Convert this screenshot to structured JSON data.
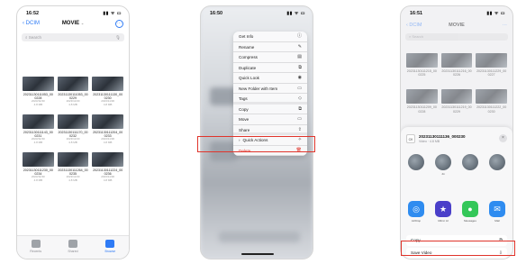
{
  "screen1": {
    "time": "16:52",
    "status_icons": "▮▮ ᯤ ▭",
    "back_label": "DCIM",
    "title": "MOVIE",
    "more_label": "···",
    "search_placeholder": "Search",
    "items": [
      {
        "name": "20231130111053_000228",
        "meta": "2023/11/30\n4.8 MB"
      },
      {
        "name": "20231130111053_000229",
        "meta": "2023/11/30\n4.8 MB"
      },
      {
        "name": "20231130111130_000230",
        "meta": "2023/11/30\n4.8 MB"
      },
      {
        "name": "20231130111143_000231",
        "meta": "2023/11/30\n4.8 MB"
      },
      {
        "name": "20231130111170_000232",
        "meta": "2023/11/30\n4.8 MB"
      },
      {
        "name": "20231130111204_000233",
        "meta": "2023/11/30\n4.8 MB"
      },
      {
        "name": "20231130111230_000234",
        "meta": "2023/11/30\n4.8 MB"
      },
      {
        "name": "20231130111264_000235",
        "meta": "2023/11/30\n4.8 MB"
      },
      {
        "name": "20231130111224_000236",
        "meta": "2023/11/30\n4.8 MB"
      }
    ],
    "tabs": [
      {
        "label": "Recents",
        "active": false
      },
      {
        "label": "Shared",
        "active": false
      },
      {
        "label": "Browse",
        "active": true
      }
    ]
  },
  "screen2": {
    "time": "16:50",
    "status_icons": "▮▮ ᯤ ▭",
    "menu": [
      {
        "label": "Get Info",
        "icon": "ⓘ",
        "icon_name": "info-icon",
        "sep": false,
        "red": false
      },
      {
        "label": "Rename",
        "icon": "✎",
        "icon_name": "pencil-icon",
        "sep": false,
        "red": false
      },
      {
        "label": "Compress",
        "icon": "▤",
        "icon_name": "archive-icon",
        "sep": false,
        "red": false
      },
      {
        "label": "Duplicate",
        "icon": "⧉",
        "icon_name": "duplicate-icon",
        "sep": false,
        "red": false
      },
      {
        "label": "Quick Look",
        "icon": "◉",
        "icon_name": "eye-icon",
        "sep": false,
        "red": false
      },
      {
        "label": "New Folder with Item",
        "icon": "▭",
        "icon_name": "folder-plus-icon",
        "sep": false,
        "red": false
      },
      {
        "label": "Tags",
        "icon": "◇",
        "icon_name": "tag-icon",
        "sep": true,
        "red": false
      },
      {
        "label": "Copy",
        "icon": "⧉",
        "icon_name": "copy-icon",
        "sep": false,
        "red": false
      },
      {
        "label": "Move",
        "icon": "▭",
        "icon_name": "folder-icon",
        "sep": false,
        "red": false
      },
      {
        "label": "Share",
        "icon": "⇪",
        "icon_name": "share-icon",
        "sep": true,
        "red": false
      },
      {
        "label": "Quick Actions",
        "icon": "✧",
        "icon_name": "quick-actions-icon",
        "sep": false,
        "red": false,
        "chevron": "›"
      },
      {
        "label": "Delete",
        "icon": "🗑",
        "icon_name": "trash-icon",
        "sep": false,
        "red": true
      }
    ],
    "highlight_color": "#e0342b"
  },
  "screen3": {
    "time": "16:51",
    "status_icons": "▮▮ ᯤ ▭",
    "back_label": "DCIM",
    "title": "MOVIE",
    "more_label": "···",
    "search_placeholder": "Search",
    "bg_items": [
      {
        "name": "20231130111215_000225"
      },
      {
        "name": "20231130111216_000226"
      },
      {
        "name": "20231130111229_000227"
      },
      {
        "name": "20231130111209_000228"
      },
      {
        "name": "20231130111219_000229"
      },
      {
        "name": "20231130111222_000230"
      }
    ],
    "share_file": {
      "icon": "CK",
      "name": "20231130111136_000230",
      "sub": "Video · 4.8 MB"
    },
    "close": "×",
    "people": [
      "",
      "Jin",
      "",
      ""
    ],
    "apps": [
      {
        "label": "AirDrop",
        "icon": "◎",
        "color": "#2f8cf0",
        "icon_name": "airdrop-icon"
      },
      {
        "label": "Mirror AI",
        "icon": "★",
        "color": "#4a3fc9",
        "icon_name": "mirror-ai-icon"
      },
      {
        "label": "Messages",
        "icon": "●",
        "color": "#34c759",
        "icon_name": "messages-icon"
      },
      {
        "label": "Mail",
        "icon": "✉",
        "color": "#2f8cf0",
        "icon_name": "mail-icon"
      }
    ],
    "actions": [
      {
        "label": "Copy",
        "icon": "⧉",
        "icon_name": "copy-icon"
      },
      {
        "label": "Save Video",
        "icon": "⇩",
        "icon_name": "save-icon"
      }
    ]
  }
}
